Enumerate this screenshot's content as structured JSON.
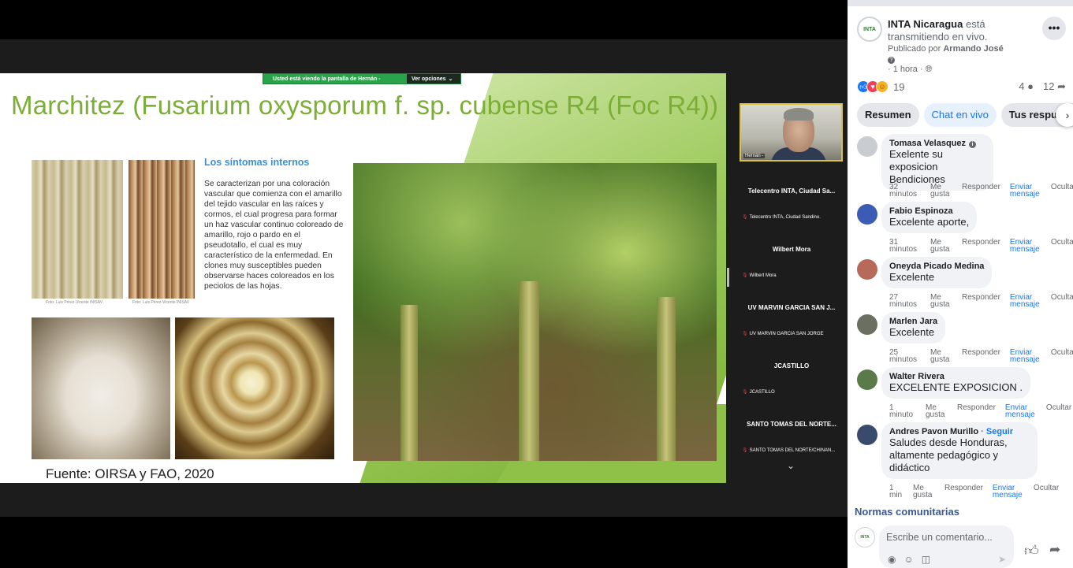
{
  "video": {
    "share_banner": "Usted está viendo la pantalla de  Hernán -  ",
    "share_options": "Ver opciones",
    "slide": {
      "title": "Marchitez (Fusarium oxysporum f. sp. cubense R4 (Foc R4))",
      "section_title": "Los síntomas internos",
      "body": "Se caracterizan por una coloración vascular que comienza con el amarillo del tejido vascular en las raíces y cormos, el cual progresa para formar un haz vascular continuo coloreado de amarillo, rojo o pardo en el pseudotallo, el cual es muy característico de la enfermedad. En clones muy susceptibles pueden observarse haces coloreados en los peciolos de las hojas.",
      "photo_credit_1": "Foto: Luis Pérez-Vicente INISAV",
      "photo_credit_2": "Foto: Luis Pérez-Vicente INISAV",
      "source": "Fuente: OIRSA y FAO, 2020"
    },
    "presenter": {
      "name": "Hernán -"
    },
    "participants": [
      {
        "display": "Telecentro INTA, Ciudad Sa...",
        "label": "Telecentro INTA, Ciudad Sandino."
      },
      {
        "display": "Wilbert Mora",
        "label": "Wilbert Mora"
      },
      {
        "display": "UV MARVIN GARCIA SAN J...",
        "label": "UV MARVIN GARCIA SAN JORGE"
      },
      {
        "display": "JCASTILLO",
        "label": "JCASTILLO"
      },
      {
        "display": "SANTO TOMAS DEL NORTE...",
        "label": "SANTO TOMAS DEL NORTE/CHINAN..."
      }
    ],
    "participants_more": "⌄"
  },
  "post": {
    "page_name": "INTA Nicaragua",
    "status": "está transmitiendo en vivo.",
    "published_by_label": "Publicado por",
    "published_by": "Armando José",
    "time": "· 1 hora ·",
    "logo_text": "INTA",
    "reaction_count": "19",
    "comment_count": "4",
    "share_count": "12"
  },
  "tabs": [
    {
      "label": "Resumen"
    },
    {
      "label": "Chat en vivo"
    },
    {
      "label": "Tus respuestas"
    }
  ],
  "comments": [
    {
      "author": "Tomasa Velasquez",
      "text": "Exelente su exposicion Bendiciones",
      "ago": "32 minutos",
      "avatar_color": "#c9ccd1"
    },
    {
      "author": "Fabio Espinoza",
      "text": "Excelente aporte,",
      "ago": "31 minutos",
      "avatar_color": "#3b5bb5"
    },
    {
      "author": "Oneyda Picado Medina",
      "text": "Excelente",
      "ago": "27 minutos",
      "avatar_color": "#b86a5a"
    },
    {
      "author": "Marlen Jara",
      "text": "Excelente",
      "ago": "25 minutos",
      "avatar_color": "#6b6f62"
    },
    {
      "author": "Walter Rivera",
      "text": "EXCELENTE EXPOSICION .",
      "ago": "1 minuto",
      "avatar_color": "#5a7a4a"
    },
    {
      "author": "Andres Pavon Murillo",
      "follow": "· Seguir",
      "text": "Saludes desde Honduras, altamente pedagógico y didáctico",
      "ago": "1 min",
      "avatar_color": "#3a4a6a"
    }
  ],
  "comment_actions": {
    "like": "Me gusta",
    "reply": "Responder",
    "message": "Enviar mensaje",
    "hide": "Ocultar"
  },
  "footer": {
    "norms": "Normas comunitarias",
    "composer_placeholder": "Escribe un comentario..."
  }
}
